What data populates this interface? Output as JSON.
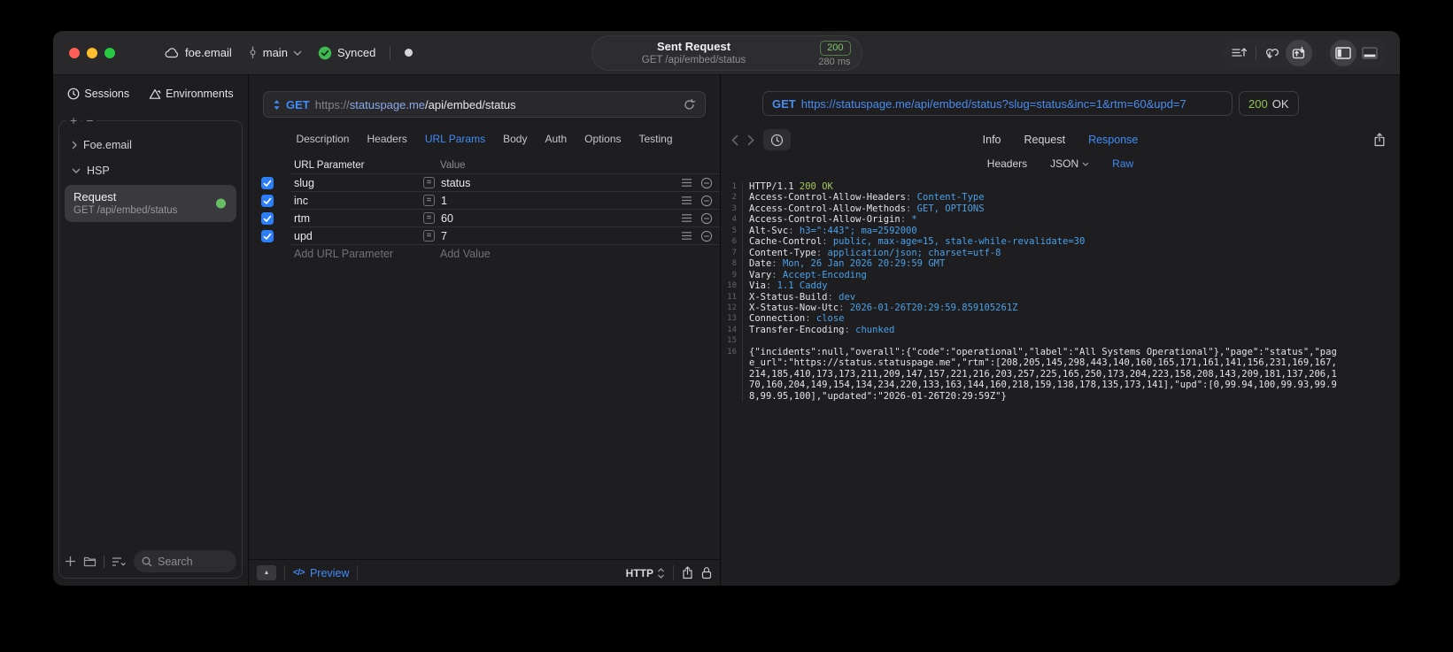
{
  "titlebar": {
    "project": "foe.email",
    "branch": "main",
    "sync_label": "Synced",
    "pill": {
      "title": "Sent Request",
      "subtitle": "GET /api/embed/status",
      "status_code": "200",
      "duration": "280 ms"
    }
  },
  "sidebar": {
    "tabs": [
      {
        "label": "Sessions"
      },
      {
        "label": "Environments"
      }
    ],
    "tree": [
      {
        "label": "Foe.email"
      },
      {
        "label": "HSP"
      }
    ],
    "request_item": {
      "title": "Request",
      "subtitle": "GET /api/embed/status"
    },
    "search_placeholder": "Search"
  },
  "request_pane": {
    "method": "GET",
    "url": {
      "scheme": "https://",
      "host": "statuspage.me",
      "path": "/api/embed/status"
    },
    "tabs": [
      "Description",
      "Headers",
      "URL Params",
      "Body",
      "Auth",
      "Options",
      "Testing"
    ],
    "active_tab": "URL Params",
    "params_table": {
      "columns": [
        "URL Parameter",
        "Value"
      ],
      "rows": [
        {
          "name": "slug",
          "value": "status",
          "checked": true
        },
        {
          "name": "inc",
          "value": "1",
          "checked": true
        },
        {
          "name": "rtm",
          "value": "60",
          "checked": true
        },
        {
          "name": "upd",
          "value": "7",
          "checked": true
        }
      ],
      "add_param_label": "Add URL Parameter",
      "add_value_label": "Add Value"
    },
    "footer": {
      "preview_label": "Preview",
      "protocol": "HTTP"
    }
  },
  "response_pane": {
    "request_line": {
      "method": "GET",
      "url": "https://statuspage.me/api/embed/status?slug=status&inc=1&rtm=60&upd=7"
    },
    "status": {
      "code": "200",
      "text": "OK"
    },
    "tabs": [
      "Info",
      "Request",
      "Response"
    ],
    "active_tab": "Response",
    "subtabs": [
      "Headers",
      "JSON",
      "Raw"
    ],
    "active_subtab": "Raw",
    "code": {
      "lines": [
        {
          "n": 1,
          "s": [
            {
              "t": "HTTP/1.1 ",
              "c": "plain"
            },
            {
              "t": "200 OK",
              "c": "green"
            }
          ]
        },
        {
          "n": 2,
          "s": [
            {
              "t": "Access-Control-Allow-Headers",
              "c": "plain"
            },
            {
              "t": ": ",
              "c": "dim"
            },
            {
              "t": "Content-Type",
              "c": "blue"
            }
          ]
        },
        {
          "n": 3,
          "s": [
            {
              "t": "Access-Control-Allow-Methods",
              "c": "plain"
            },
            {
              "t": ": ",
              "c": "dim"
            },
            {
              "t": "GET, OPTIONS",
              "c": "blue"
            }
          ]
        },
        {
          "n": 4,
          "s": [
            {
              "t": "Access-Control-Allow-Origin",
              "c": "plain"
            },
            {
              "t": ": ",
              "c": "dim"
            },
            {
              "t": "*",
              "c": "blue"
            }
          ]
        },
        {
          "n": 5,
          "s": [
            {
              "t": "Alt-Svc",
              "c": "plain"
            },
            {
              "t": ": ",
              "c": "dim"
            },
            {
              "t": "h3=\":443\"; ma=2592000",
              "c": "blue"
            }
          ]
        },
        {
          "n": 6,
          "s": [
            {
              "t": "Cache-Control",
              "c": "plain"
            },
            {
              "t": ": ",
              "c": "dim"
            },
            {
              "t": "public, max-age=15, stale-while-revalidate=30",
              "c": "blue"
            }
          ]
        },
        {
          "n": 7,
          "s": [
            {
              "t": "Content-Type",
              "c": "plain"
            },
            {
              "t": ": ",
              "c": "dim"
            },
            {
              "t": "application/json; charset=utf-8",
              "c": "blue"
            }
          ]
        },
        {
          "n": 8,
          "s": [
            {
              "t": "Date",
              "c": "plain"
            },
            {
              "t": ": ",
              "c": "dim"
            },
            {
              "t": "Mon, 26 Jan 2026 20:29:59 GMT",
              "c": "blue"
            }
          ]
        },
        {
          "n": 9,
          "s": [
            {
              "t": "Vary",
              "c": "plain"
            },
            {
              "t": ": ",
              "c": "dim"
            },
            {
              "t": "Accept-Encoding",
              "c": "blue"
            }
          ]
        },
        {
          "n": 10,
          "s": [
            {
              "t": "Via",
              "c": "plain"
            },
            {
              "t": ": ",
              "c": "dim"
            },
            {
              "t": "1.1 Caddy",
              "c": "blue"
            }
          ]
        },
        {
          "n": 11,
          "s": [
            {
              "t": "X-Status-Build",
              "c": "plain"
            },
            {
              "t": ": ",
              "c": "dim"
            },
            {
              "t": "dev",
              "c": "blue"
            }
          ]
        },
        {
          "n": 12,
          "s": [
            {
              "t": "X-Status-Now-Utc",
              "c": "plain"
            },
            {
              "t": ": ",
              "c": "dim"
            },
            {
              "t": "2026-01-26T20:29:59.859105261Z",
              "c": "blue"
            }
          ]
        },
        {
          "n": 13,
          "s": [
            {
              "t": "Connection",
              "c": "plain"
            },
            {
              "t": ": ",
              "c": "dim"
            },
            {
              "t": "close",
              "c": "blue"
            }
          ]
        },
        {
          "n": 14,
          "s": [
            {
              "t": "Transfer-Encoding",
              "c": "plain"
            },
            {
              "t": ": ",
              "c": "dim"
            },
            {
              "t": "chunked",
              "c": "blue"
            }
          ]
        },
        {
          "n": 15,
          "s": []
        },
        {
          "n": 16,
          "s": [
            {
              "t": "{\"incidents\":null,\"overall\":{\"code\":\"operational\",\"label\":\"All Systems Operational\"},\"page\":\"status\",\"page_url\":\"https://status.statuspage.me\",\"rtm\":[208,205,145,298,443,140,160,165,171,161,141,156,231,169,167,214,185,410,173,173,211,209,147,157,221,216,203,257,225,165,250,173,204,223,158,208,143,209,181,137,206,170,160,204,149,154,134,234,220,133,163,144,160,218,159,138,178,135,173,141],\"upd\":[0,99.94,100,99.93,99.98,99.95,100],\"updated\":\"2026-01-26T20:29:59Z\"}",
              "c": "plain"
            }
          ]
        }
      ]
    }
  },
  "colors": {
    "accent_blue": "#3f8cf7",
    "code_blue": "#4aa0e8",
    "code_green": "#a3c65a",
    "status_badge_green": "#84c96b",
    "checkbox_blue": "#2c7ef8",
    "traffic_red": "#ff5f57",
    "traffic_yellow": "#febc2e",
    "traffic_green": "#28c840"
  },
  "icons": {
    "cloud-icon": "cloud",
    "branch-icon": "commit",
    "chevron-down-icon": "v",
    "sync-check-icon": "check-circle",
    "session-dot": "dot",
    "export-lines-icon": "lines-up-arrow",
    "sync-loop-icon": "loop-down-arrow",
    "resend-box-icon": "box-arrows",
    "sidebar-toggle-icon": "panel-left",
    "bottom-panel-toggle-icon": "panel-bottom",
    "clock-icon": "clock",
    "environments-icon": "triangle-cycle",
    "plus-icon": "+",
    "minus-icon": "-",
    "folder-icon": "folder",
    "list-options-icon": "lines-chevron",
    "search-icon": "magnifier",
    "method-updown-icon": "up-down-triangles",
    "refresh-icon": "circular-arrow",
    "equals-icon": "=",
    "drag-handle-icon": "hamburger",
    "remove-row-icon": "minus-circle",
    "collapse-icon": "up-triangle",
    "code-icon": "angle-brackets",
    "protocol-updown-icon": "chevrons-up-down",
    "share-icon": "box-up-arrow",
    "lock-icon": "padlock",
    "back-icon": "chevron-left",
    "forward-icon": "chevron-right"
  }
}
